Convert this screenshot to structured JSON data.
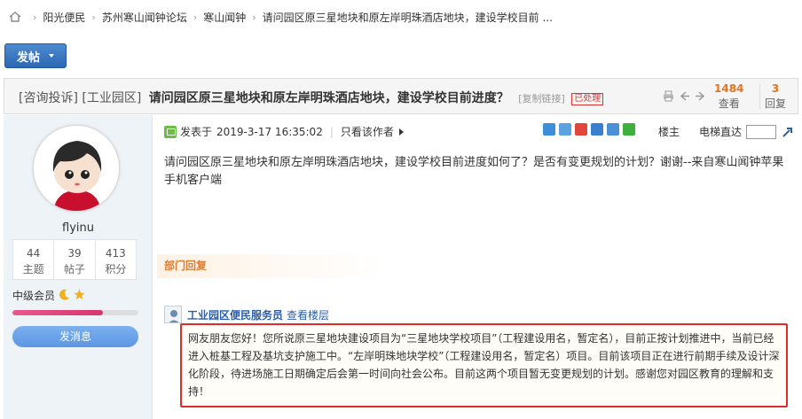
{
  "breadcrumb": {
    "items": [
      "阳光便民",
      "苏州寒山闻钟论坛",
      "寒山闻钟",
      "请问园区原三星地块和原左岸明珠酒店地块，建设学校目前 ..."
    ],
    "separator": "›"
  },
  "toolbar": {
    "post_label": "发帖"
  },
  "thread": {
    "tag1": "[咨询投诉]",
    "tag2": "[工业园区]",
    "subject": "请问园区原三星地块和原左岸明珠酒店地块，建设学校目前进度？",
    "copy_link": "[复制链接]",
    "badge": "已处理",
    "views_count": "1484",
    "views_label": "查看",
    "replies_count": "3",
    "replies_label": "回复"
  },
  "author": {
    "name": "flyinu",
    "stats": [
      {
        "value": "44",
        "label": "主题"
      },
      {
        "value": "39",
        "label": "帖子"
      },
      {
        "value": "413",
        "label": "积分"
      }
    ],
    "level": "中级会员",
    "progress": 0.72,
    "message_button": "发消息"
  },
  "post": {
    "posted_prefix": "发表于",
    "posted_time": "2019-3-17 16:35:02",
    "only_author": "只看该作者",
    "floor_label": "楼主",
    "goto_label": "电梯直达",
    "body": "请问园区原三星地块和原左岸明珠酒店地块，建设学校目前进度如何了？是否有变更规划的计划？谢谢--来自寒山闻钟苹果手机客户端"
  },
  "department_reply": {
    "header": "部门回复",
    "author": "工业园区便民服务员",
    "view_floor": "查看楼层",
    "text": "网友朋友您好！您所说原三星地块建设项目为“三星地块学校项目”（工程建设用名，暂定名），目前正按计划推进中，当前已经进入桩基工程及基坑支护施工中。“左岸明珠地块学校”（工程建设用名，暂定名）项目。目前该项目正在进行前期手续及设计深化阶段，待进场施工日期确定后会第一时间向社会公布。目前这两个项目暂无变更规划的计划。感谢您对园区教育的理解和支持！"
  },
  "colors": {
    "accent_blue": "#2d68b3",
    "stat_orange": "#e6731e",
    "highlight_red": "#e02b2b",
    "dept_orange": "#e07b2e"
  },
  "icons": [
    "home-icon",
    "print-icon",
    "prev-icon",
    "next-icon",
    "share-icons",
    "jump-icon"
  ]
}
